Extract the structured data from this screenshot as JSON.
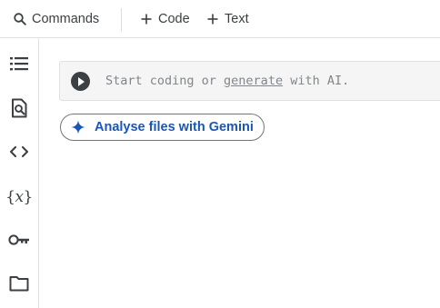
{
  "toolbar": {
    "commands_label": "Commands",
    "code_label": "Code",
    "text_label": "Text"
  },
  "sidebar": {
    "items": [
      {
        "name": "table-of-contents",
        "icon": "toc-icon"
      },
      {
        "name": "find-and-replace",
        "icon": "find-in-page-icon"
      },
      {
        "name": "code-snippets",
        "icon": "code-brackets-icon"
      },
      {
        "name": "variables",
        "icon": "variables-icon",
        "glyph_left": "{",
        "glyph_mid": "x",
        "glyph_right": "}"
      },
      {
        "name": "secrets",
        "icon": "key-icon"
      },
      {
        "name": "files",
        "icon": "folder-icon"
      }
    ]
  },
  "cell": {
    "placeholder_start": "Start coding or ",
    "placeholder_link": "generate",
    "placeholder_end": " with AI."
  },
  "gemini": {
    "label": "Analyse files with Gemini",
    "accent": "#1a57b5"
  },
  "colors": {
    "icon": "#3c4043",
    "border": "#e0e0e0",
    "cell_bg": "#f5f5f5"
  }
}
